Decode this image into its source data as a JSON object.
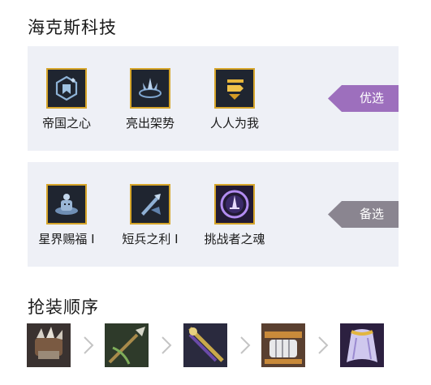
{
  "hex_tech": {
    "title": "海克斯科技",
    "groups": [
      {
        "tag": "优选",
        "tag_color": "#9d6fbd",
        "augments": [
          {
            "label": "帝国之心",
            "icon": "imperial-heart-icon"
          },
          {
            "label": "亮出架势",
            "icon": "crown-stance-icon"
          },
          {
            "label": "人人为我",
            "icon": "all-for-one-icon"
          }
        ]
      },
      {
        "tag": "备选",
        "tag_color": "#8a8590",
        "augments": [
          {
            "label": "星界赐福 I",
            "icon": "astral-blessing-icon"
          },
          {
            "label": "短兵之利 I",
            "icon": "short-blade-icon"
          },
          {
            "label": "挑战者之魂",
            "icon": "challenger-soul-icon"
          }
        ]
      }
    ]
  },
  "build_order": {
    "title": "抢装顺序",
    "items": [
      {
        "icon": "spiked-gauntlet-item-icon"
      },
      {
        "icon": "spear-item-icon"
      },
      {
        "icon": "scepter-item-icon"
      },
      {
        "icon": "armored-fist-item-icon"
      },
      {
        "icon": "cloak-item-icon"
      }
    ],
    "separator_icon": "chevron-right-icon"
  },
  "colors": {
    "panel_bg": "#eef0f6",
    "icon_frame": "#d6a52a",
    "text": "#1a1a1a"
  }
}
